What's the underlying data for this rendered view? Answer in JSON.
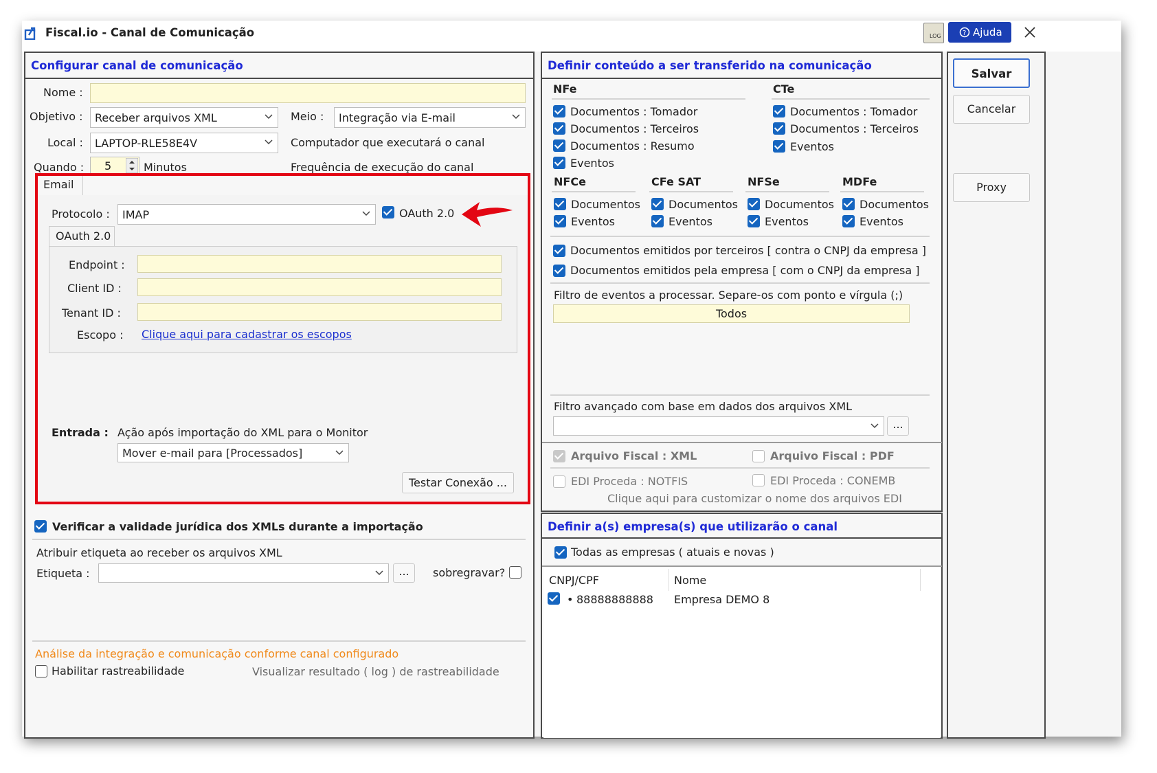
{
  "window": {
    "title": "Fiscal.io - Canal de Comunicação",
    "help_label": "Ajuda",
    "log_icon_label": "LOG"
  },
  "left": {
    "title": "Configurar canal de comunicação",
    "nome_label": "Nome :",
    "nome_value": "",
    "objetivo_label": "Objetivo :",
    "objetivo_value": "Receber arquivos XML",
    "meio_label": "Meio :",
    "meio_value": "Integração via E-mail",
    "local_label": "Local :",
    "local_value": "LAPTOP-RLE58E4V",
    "local_desc": "Computador que executará o canal",
    "quando_label": "Quando :",
    "quando_value": "5",
    "quando_unit": "Minutos",
    "quando_desc": "Frequência de execução do canal",
    "email_tab": "Email",
    "protocolo_label": "Protocolo :",
    "protocolo_value": "IMAP",
    "oauth_check_label": "OAuth 2.0",
    "oauth_check_checked": true,
    "oauth_tab": "OAuth 2.0",
    "endpoint_label": "Endpoint :",
    "clientid_label": "Client ID :",
    "tenantid_label": "Tenant ID :",
    "escopo_label": "Escopo :",
    "escopo_link": "Clique aqui para cadastrar os escopos",
    "entrada_label": "Entrada :",
    "entrada_desc": "Ação após importação do XML para o Monitor",
    "entrada_value": "Mover e-mail para [Processados]",
    "testar_button": "Testar Conexão ...",
    "verificar_label": "Verificar a validade jurídica dos XMLs durante a importação",
    "verificar_checked": true,
    "atribuir_label": "Atribuir etiqueta ao receber os arquivos XML",
    "etiqueta_label": "Etiqueta :",
    "etiqueta_value": "",
    "etiqueta_more": "...",
    "sobregravar_label": "sobregravar?",
    "analise_label": "Análise da integração e comunicação conforme canal configurado",
    "habilitar_label": "Habilitar rastreabilidade",
    "visualizar_label": "Visualizar resultado ( log ) de rastreabilidade",
    "accent_color": "#e30613",
    "analise_color": "#f08a1c"
  },
  "middle": {
    "title": "Definir conteúdo a ser transferido na comunicação",
    "nfe": {
      "title": "NFe",
      "items": [
        "Documentos : Tomador",
        "Documentos : Terceiros",
        "Documentos : Resumo",
        "Eventos"
      ]
    },
    "cte": {
      "title": "CTe",
      "items": [
        "Documentos : Tomador",
        "Documentos : Terceiros",
        "Eventos"
      ]
    },
    "nfce": {
      "title": "NFCe",
      "items": [
        "Documentos",
        "Eventos"
      ]
    },
    "cfesat": {
      "title": "CFe SAT",
      "items": [
        "Documentos",
        "Eventos"
      ]
    },
    "nfse": {
      "title": "NFSe",
      "items": [
        "Documentos",
        "Eventos"
      ]
    },
    "mdfe": {
      "title": "MDFe",
      "items": [
        "Documentos",
        "Eventos"
      ]
    },
    "emitidos_terceiros": "Documentos emitidos por terceiros [ contra o CNPJ da empresa ]",
    "emitidos_empresa": "Documentos emitidos pela empresa [ com o CNPJ da empresa ]",
    "filtro_eventos_label": "Filtro de eventos a processar. Separe-os com ponto e vírgula (;)",
    "filtro_eventos_value": "Todos",
    "filtro_avancado_label": "Filtro avançado com base em dados dos arquivos XML",
    "filtro_avancado_more": "...",
    "arquivo_xml": "Arquivo Fiscal : XML",
    "arquivo_pdf": "Arquivo Fiscal : PDF",
    "edi_notfis": "EDI Proceda : NOTFIS",
    "edi_conemb": "EDI Proceda : CONEMB",
    "edi_customizar": "Clique aqui para customizar o nome dos arquivos EDI"
  },
  "empresas": {
    "title": "Definir a(s) empresa(s) que utilizarão o canal",
    "todas_label": "Todas as empresas  ( atuais e novas )",
    "col_cnpj": "CNPJ/CPF",
    "col_nome": "Nome",
    "rows": [
      {
        "cnpj": "88888888888",
        "nome": "Empresa DEMO 8",
        "bullet": "•"
      }
    ]
  },
  "actions": {
    "salvar": "Salvar",
    "cancelar": "Cancelar",
    "proxy": "Proxy"
  }
}
